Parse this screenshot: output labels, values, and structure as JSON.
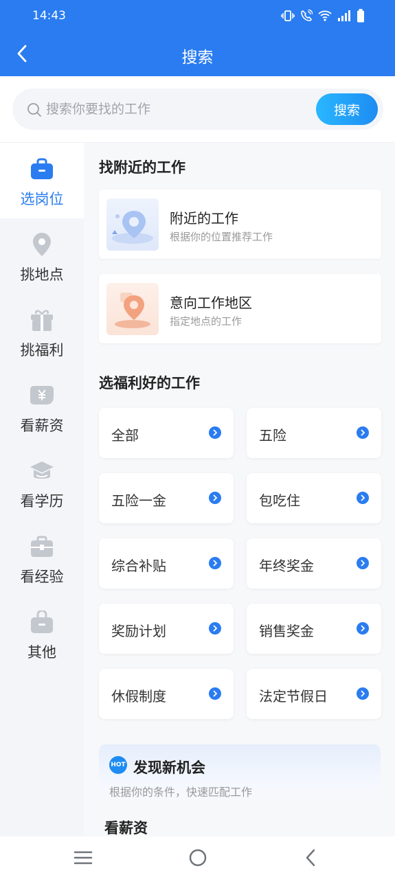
{
  "status": {
    "time": "14:43"
  },
  "header": {
    "title": "搜索"
  },
  "search": {
    "placeholder": "搜索你要找的工作",
    "button": "搜索"
  },
  "sidebar": {
    "items": [
      {
        "label": "选岗位",
        "icon": "briefcase-icon",
        "active": true
      },
      {
        "label": "挑地点",
        "icon": "location-pin-icon",
        "active": false
      },
      {
        "label": "挑福利",
        "icon": "gift-icon",
        "active": false
      },
      {
        "label": "看薪资",
        "icon": "yen-wallet-icon",
        "active": false
      },
      {
        "label": "看学历",
        "icon": "graduation-cap-icon",
        "active": false
      },
      {
        "label": "看经验",
        "icon": "toolbox-icon",
        "active": false
      },
      {
        "label": "其他",
        "icon": "bag-icon",
        "active": false
      }
    ]
  },
  "nearby": {
    "title": "找附近的工作",
    "cards": [
      {
        "title": "附近的工作",
        "subtitle": "根据你的位置推荐工作"
      },
      {
        "title": "意向工作地区",
        "subtitle": "指定地点的工作"
      }
    ]
  },
  "benefits": {
    "title": "选福利好的工作",
    "items": [
      "全部",
      "五险",
      "五险一金",
      "包吃住",
      "综合补贴",
      "年终奖金",
      "奖励计划",
      "销售奖金",
      "休假制度",
      "法定节假日"
    ]
  },
  "opportunity": {
    "badge": "HOT",
    "title": "发现新机会",
    "subtitle": "根据你的条件，快速匹配工作"
  },
  "salary": {
    "title": "看薪资"
  },
  "colors": {
    "primary": "#2A7CF0",
    "sidebar_bg": "#f3f5f9",
    "icon_gray": "#c3c7ce"
  }
}
